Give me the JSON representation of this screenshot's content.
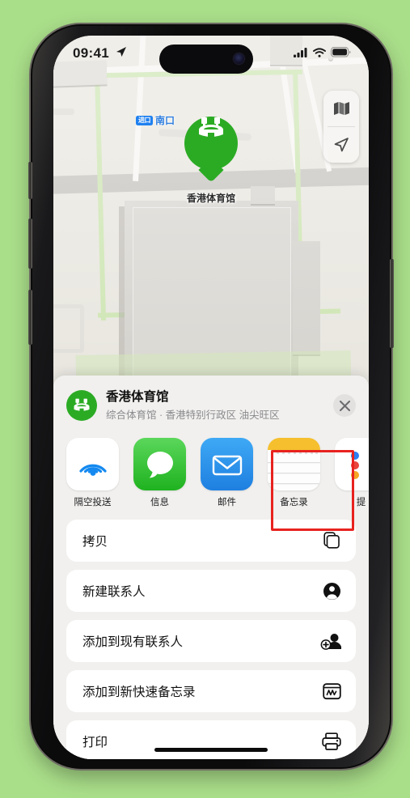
{
  "status_bar": {
    "time": "09:41",
    "location_arrow_icon": "location-arrow-icon",
    "cellular_icon": "cellular-signal-icon",
    "wifi_icon": "wifi-icon",
    "battery_icon": "battery-full-icon"
  },
  "map": {
    "label_badge": "进口",
    "label_text": "南口",
    "pin_label": "香港体育馆",
    "pin_icon": "stadium-icon",
    "pin_color": "#2bab24",
    "controls": [
      {
        "name": "map-layers-icon",
        "glyph": "layers"
      },
      {
        "name": "locate-me-icon",
        "glyph": "arrow"
      }
    ]
  },
  "share_sheet": {
    "place_icon": "stadium-icon",
    "title": "香港体育馆",
    "subtitle": "综合体育馆 · 香港特别行政区 油尖旺区",
    "close_label": "×",
    "apps": [
      {
        "label": "隔空投送",
        "icon": "airdrop-icon",
        "tile_class": "tile-airdrop"
      },
      {
        "label": "信息",
        "icon": "messages-icon",
        "tile_class": "tile-messages"
      },
      {
        "label": "邮件",
        "icon": "mail-icon",
        "tile_class": "tile-mail"
      },
      {
        "label": "备忘录",
        "icon": "notes-icon",
        "tile_class": "tile-notes"
      },
      {
        "label": "提",
        "icon": "slack-icon",
        "tile_class": "tile-slack"
      }
    ],
    "highlighted_app": "备忘录",
    "highlight_color": "#e8221f",
    "actions": [
      {
        "label": "拷贝",
        "icon": "copy-icon"
      },
      {
        "label": "新建联系人",
        "icon": "person-circle-icon"
      },
      {
        "label": "添加到现有联系人",
        "icon": "person-add-icon"
      },
      {
        "label": "添加到新快速备忘录",
        "icon": "quick-note-icon"
      },
      {
        "label": "打印",
        "icon": "printer-icon"
      }
    ]
  },
  "background_color": "#aadf8a"
}
